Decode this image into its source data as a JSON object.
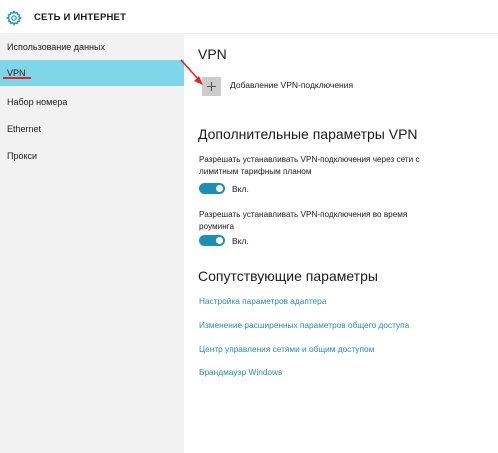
{
  "window": {
    "title": "СЕТЬ И ИНТЕРНЕТ"
  },
  "sidebar": {
    "items": [
      {
        "label": "Использование данных"
      },
      {
        "label": "VPN"
      },
      {
        "label": "Набор номера"
      },
      {
        "label": "Ethernet"
      },
      {
        "label": "Прокси"
      }
    ],
    "selected": "VPN",
    "selected_color": "#7fd6e8"
  },
  "main": {
    "vpn_heading": "VPN",
    "add_vpn": {
      "icon": "plus-icon",
      "label": "Добавление VPN-подключения"
    },
    "advanced_heading": "Дополнительные параметры VPN",
    "metered_setting": {
      "line1": "Разрешать устанавливать VPN-подключения через сети с",
      "line2": "лимитным тарифным планом",
      "state_label": "Вкл."
    },
    "roaming_setting": {
      "line1": "Разрешать устанавливать VPN-подключения во время",
      "line2": "роуминга",
      "state_label": "Вкл."
    },
    "related_heading": "Сопутствующие параметры",
    "links": [
      "Настройка параметров адаптера",
      "Изменение расширенных параметров общего доступа",
      "Центр управления сетями и общим доступом",
      "Брандмауэр Windows"
    ]
  },
  "colors": {
    "accent": "#1d8fb5",
    "link": "#2a8ab3",
    "annotation": "#e12424"
  }
}
